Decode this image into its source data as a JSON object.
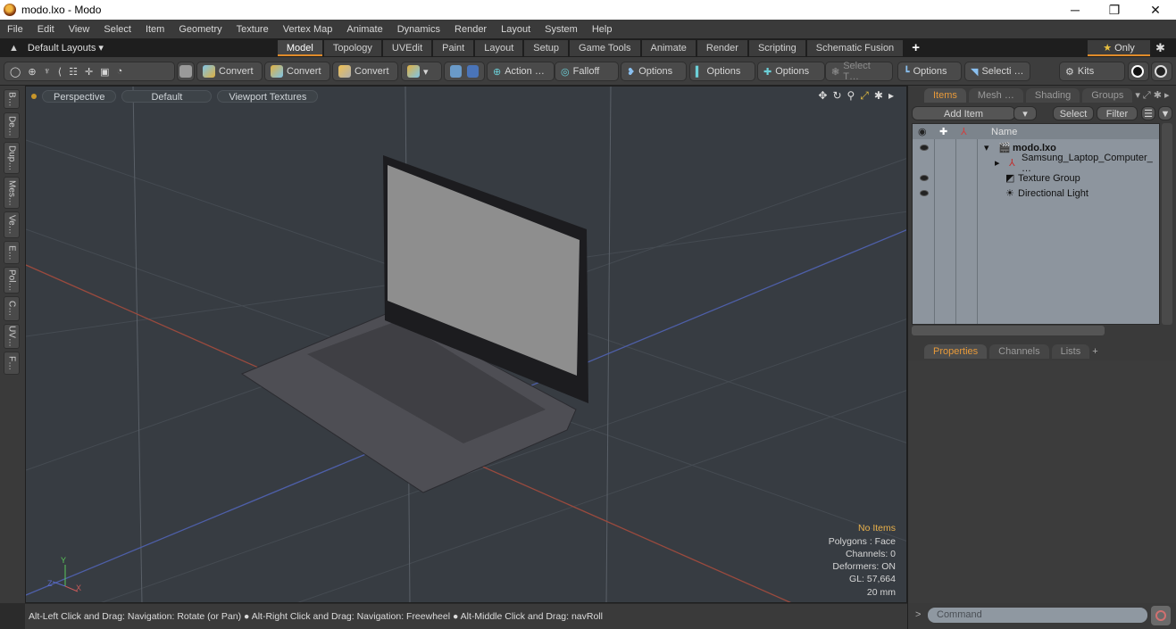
{
  "window": {
    "title": "modo.lxo - Modo",
    "controls": [
      "minimize",
      "restore",
      "close"
    ]
  },
  "menu": [
    "File",
    "Edit",
    "View",
    "Select",
    "Item",
    "Geometry",
    "Texture",
    "Vertex Map",
    "Animate",
    "Dynamics",
    "Render",
    "Layout",
    "System",
    "Help"
  ],
  "layouts": {
    "dropdown": "Default Layouts ▾",
    "tabs": [
      "Model",
      "Topology",
      "UVEdit",
      "Paint",
      "Layout",
      "Setup",
      "Game Tools",
      "Animate",
      "Render",
      "Scripting",
      "Schematic Fusion"
    ],
    "active": "Model",
    "add": "+",
    "only": "Only"
  },
  "toolbar": {
    "convert": [
      "Convert",
      "Convert",
      "Convert"
    ],
    "action": "Action …",
    "falloff": "Falloff",
    "options1": "Options",
    "options2": "Options",
    "options3": "Options",
    "select_t": "Select T…",
    "options4": "Options",
    "selecti": "Selecti …",
    "kits": "Kits"
  },
  "left_tabs": [
    "B…",
    "De…",
    "Dup…",
    "Mes…",
    "Ve…",
    "E…",
    "Pol…",
    "C…",
    "UV…",
    "F…"
  ],
  "viewport": {
    "view": "Perspective",
    "shading": "Default",
    "textures": "Viewport Textures",
    "hud": {
      "selection": "No Items",
      "polygons": "Polygons : Face",
      "channels": "Channels: 0",
      "deformers": "Deformers: ON",
      "gl": "GL: 57,664",
      "scale": "20 mm"
    },
    "colors": {
      "bg": "#373c42",
      "x_axis": "#b84a3a",
      "z_axis": "#4a5eb8",
      "hud_highlight": "#e8b04a"
    }
  },
  "status": "Alt-Left Click and Drag: Navigation: Rotate (or Pan) ● Alt-Right Click and Drag: Navigation: Freewheel ● Alt-Middle Click and Drag: navRoll",
  "items_panel": {
    "tabs": [
      "Items",
      "Mesh …",
      "Shading",
      "Groups"
    ],
    "active": "Items",
    "add_item": "Add Item",
    "select": "Select",
    "filter": "Filter",
    "column": "Name",
    "rows": [
      {
        "name": "modo.lxo",
        "visible": true,
        "icon": "scene-icon",
        "bold": true
      },
      {
        "name": "Samsung_Laptop_Computer_ …",
        "visible": false,
        "icon": "mesh-locator-icon"
      },
      {
        "name": "Texture Group",
        "visible": true,
        "icon": "texture-group-icon"
      },
      {
        "name": "Directional Light",
        "visible": true,
        "icon": "light-icon"
      }
    ]
  },
  "properties_panel": {
    "tabs": [
      "Properties",
      "Channels",
      "Lists"
    ],
    "active": "Properties",
    "add": "+"
  },
  "command": {
    "placeholder": "Command",
    "prompt": ">"
  }
}
